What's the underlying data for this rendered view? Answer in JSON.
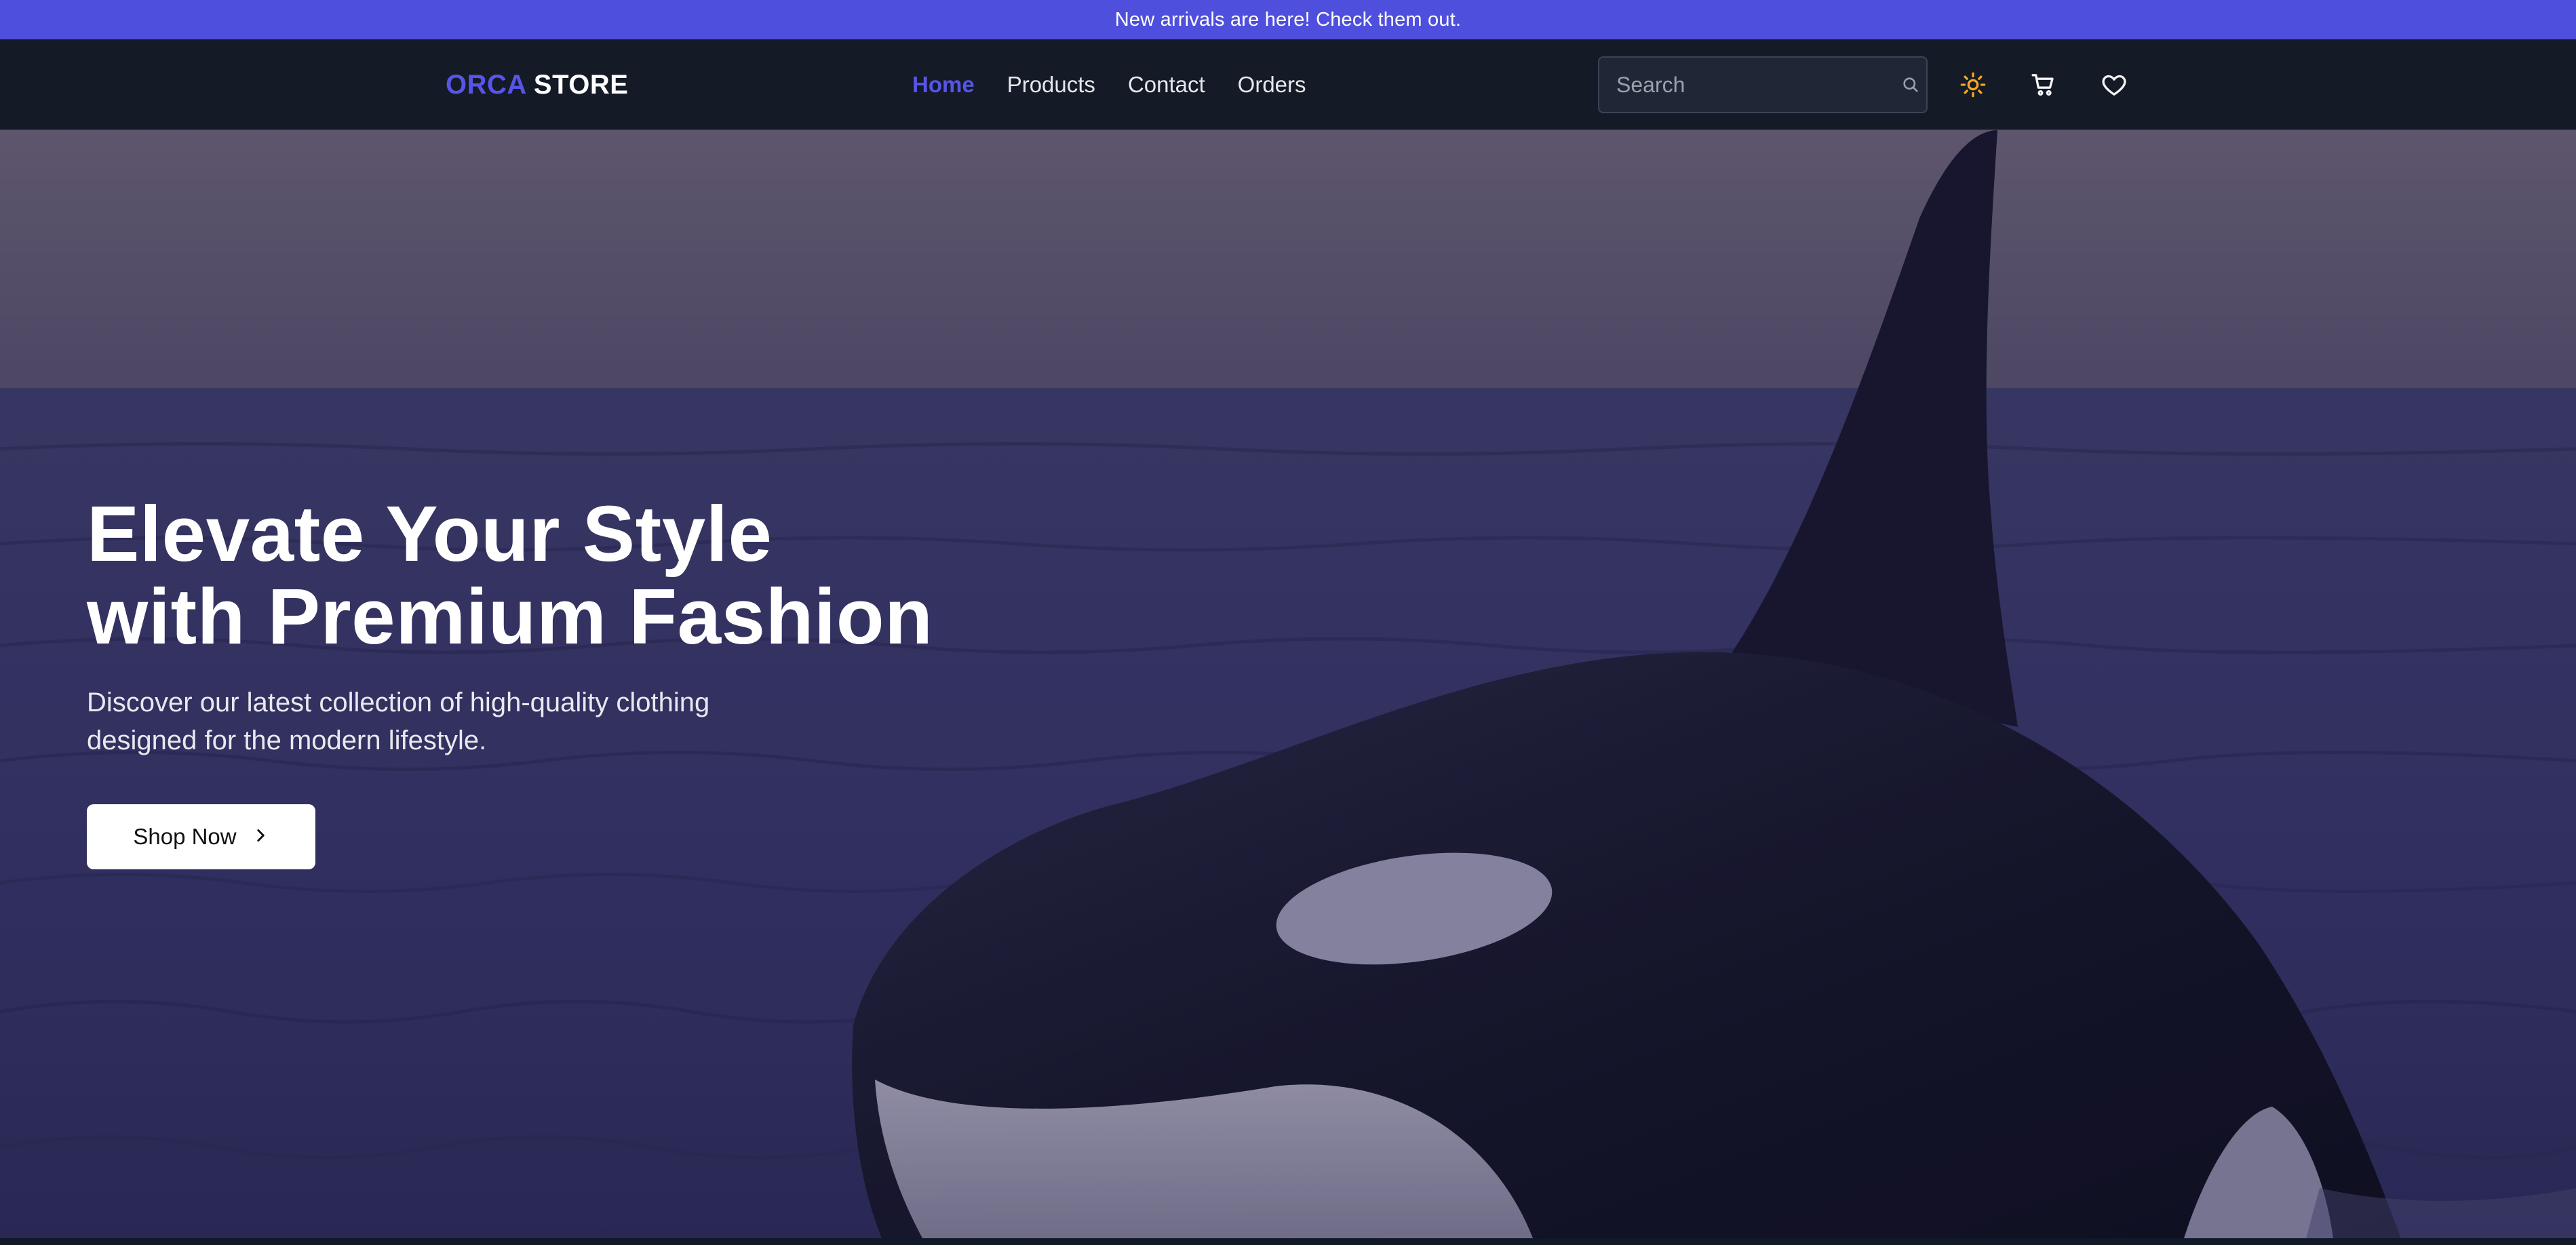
{
  "announcement": {
    "text": "New arrivals are here! Check them out."
  },
  "brand": {
    "accent": "ORCA",
    "rest": " STORE",
    "accent_color": "#5755e6"
  },
  "nav": {
    "items": [
      {
        "label": "Home",
        "active": true
      },
      {
        "label": "Products",
        "active": false
      },
      {
        "label": "Contact",
        "active": false
      },
      {
        "label": "Orders",
        "active": false
      }
    ]
  },
  "search": {
    "placeholder": "Search",
    "icon": "search-icon"
  },
  "actions": {
    "theme_icon": "sun-icon",
    "cart_icon": "cart-icon",
    "wishlist_icon": "heart-icon"
  },
  "hero": {
    "headline_line1": "Elevate Your Style",
    "headline_line2": "with Premium Fashion",
    "subtext_line1": "Discover our latest collection of high-quality clothing",
    "subtext_line2": "designed for the modern lifestyle.",
    "cta_label": "Shop Now",
    "cta_icon": "chevron-right-icon",
    "image": "orca-in-ocean"
  },
  "colors": {
    "announcement_bg": "#4f4fdd",
    "navbar_bg": "#141a26",
    "sun_icon": "#f5a524"
  }
}
